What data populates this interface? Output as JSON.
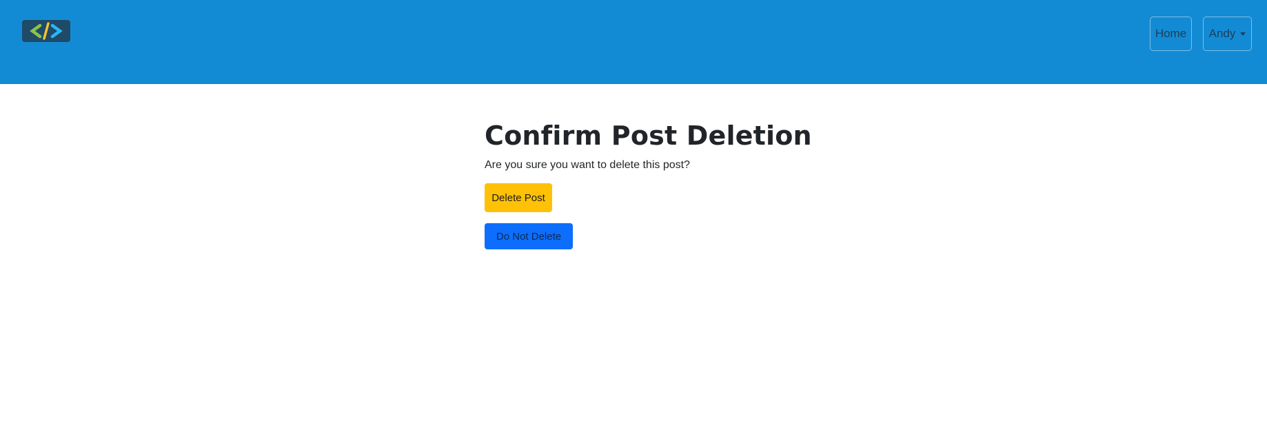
{
  "navbar": {
    "logo_icon": "code-brackets-icon",
    "home_label": "Home",
    "user_label": "Andy",
    "dropdown_icon": "caret-down-icon",
    "background_color": "#138bd4"
  },
  "main": {
    "title": "Confirm Post Deletion",
    "message": "Are you sure you want to delete this post?",
    "delete_button_label": "Delete Post",
    "cancel_button_label": "Do Not Delete"
  },
  "colors": {
    "delete_button": "#ffc107",
    "cancel_button": "#0d6efd"
  }
}
